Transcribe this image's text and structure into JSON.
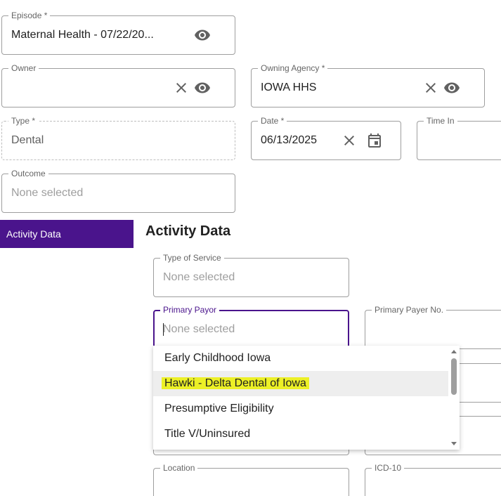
{
  "form": {
    "episode": {
      "label": "Episode *",
      "value": "Maternal Health - 07/22/20..."
    },
    "owner": {
      "label": "Owner",
      "value": ""
    },
    "owning_agency": {
      "label": "Owning Agency *",
      "value": "IOWA HHS"
    },
    "type": {
      "label": "Type *",
      "value": "Dental"
    },
    "date": {
      "label": "Date *",
      "value": "06/13/2025"
    },
    "time_in": {
      "label": "Time In",
      "value": ""
    },
    "outcome": {
      "label": "Outcome",
      "placeholder": "None selected"
    }
  },
  "sidebar": {
    "active_tab": "Activity Data"
  },
  "activity": {
    "title": "Activity Data",
    "type_of_service": {
      "label": "Type of Service",
      "placeholder": "None selected"
    },
    "primary_payor": {
      "label": "Primary Payor",
      "placeholder": "None selected"
    },
    "primary_payer_no": {
      "label": "Primary Payer No.",
      "value": ""
    },
    "location": {
      "label": "Location"
    },
    "icd10": {
      "label": "ICD-10"
    }
  },
  "dropdown": {
    "options": [
      "Early Childhood Iowa",
      "Hawki - Delta Dental of Iowa",
      "Presumptive Eligibility",
      "Title V/Uninsured"
    ],
    "hovered_index": 1,
    "highlight_color": "#ecf026"
  },
  "icons": {
    "visibility": "eye-icon",
    "clear": "close-icon",
    "calendar": "calendar-icon"
  },
  "colors": {
    "accent": "#4a148c",
    "border": "#9e9e9e",
    "hover": "#eeeeee"
  }
}
